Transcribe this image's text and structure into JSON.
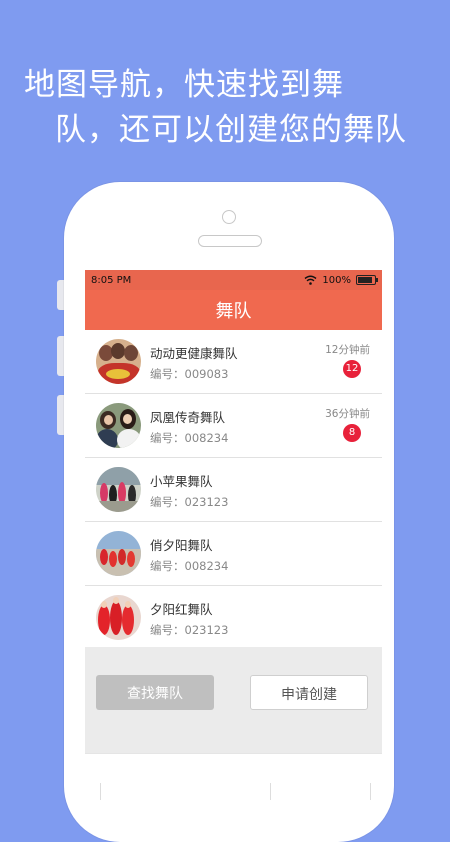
{
  "promo": {
    "line1": "地图导航，快速找到舞",
    "line2": "队，还可以创建您的舞队"
  },
  "status": {
    "time": "8:05 PM",
    "battery": "100%"
  },
  "header": {
    "title": "舞队"
  },
  "teams": [
    {
      "name": "动动更健康舞队",
      "code": "编号：009083",
      "time": "12分钟前",
      "badge": "12"
    },
    {
      "name": "凤凰传奇舞队",
      "code": "编号：008234",
      "time": "36分钟前",
      "badge": "8"
    },
    {
      "name": "小苹果舞队",
      "code": "编号：023123"
    },
    {
      "name": "俏夕阳舞队",
      "code": "编号：008234"
    },
    {
      "name": "夕阳红舞队",
      "code": "编号：023123"
    }
  ],
  "actions": {
    "find_label": "查找舞队",
    "create_label": "申请创建"
  },
  "colors": {
    "background": "#7f9bf0",
    "accent": "#f0694f",
    "badge": "#e8213a"
  }
}
